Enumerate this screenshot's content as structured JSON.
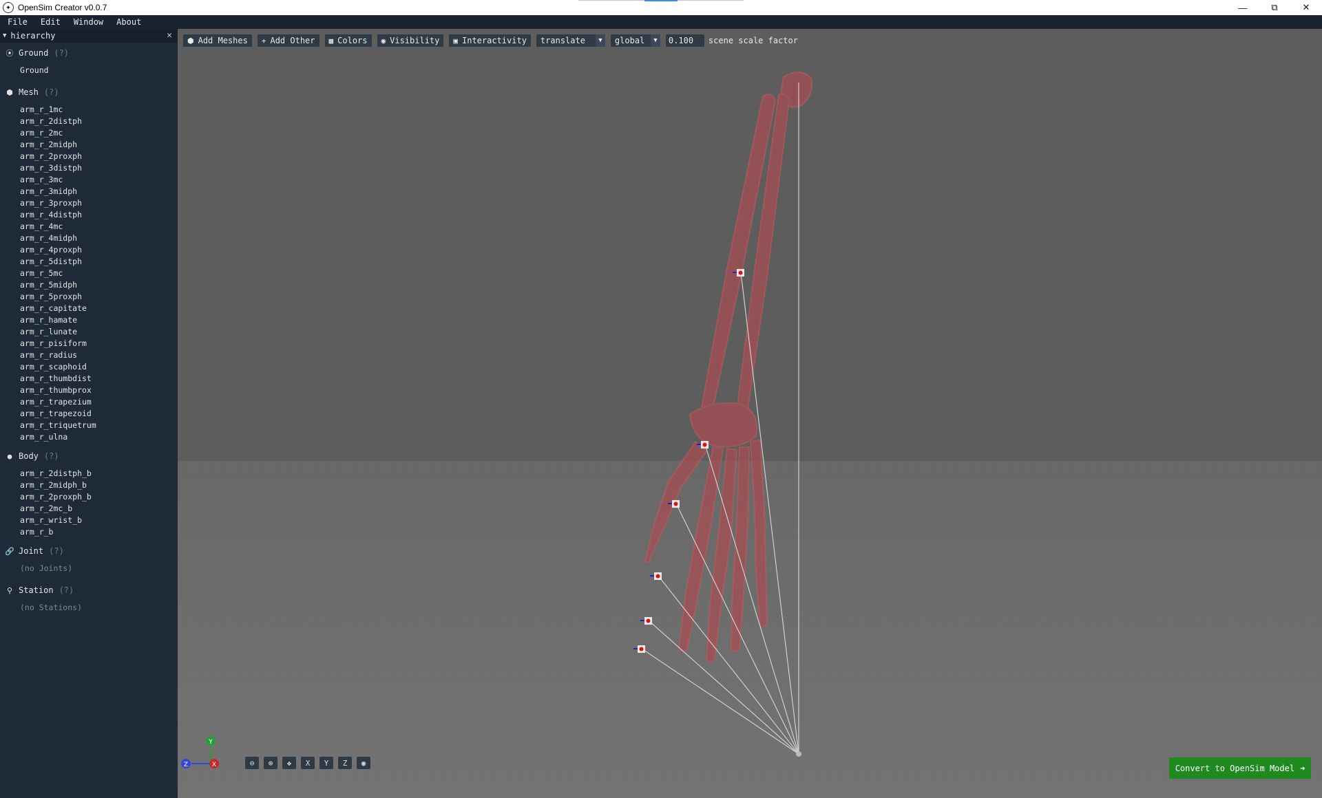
{
  "window": {
    "title": "OpenSim Creator v0.0.7"
  },
  "menu": [
    "File",
    "Edit",
    "Window",
    "About"
  ],
  "panel": {
    "title": "hierarchy"
  },
  "groups": {
    "ground": {
      "label": "Ground",
      "help": "(?)",
      "items": [
        "Ground"
      ]
    },
    "mesh": {
      "label": "Mesh",
      "help": "(?)",
      "items": [
        "arm_r_1mc",
        "arm_r_2distph",
        "arm_r_2mc",
        "arm_r_2midph",
        "arm_r_2proxph",
        "arm_r_3distph",
        "arm_r_3mc",
        "arm_r_3midph",
        "arm_r_3proxph",
        "arm_r_4distph",
        "arm_r_4mc",
        "arm_r_4midph",
        "arm_r_4proxph",
        "arm_r_5distph",
        "arm_r_5mc",
        "arm_r_5midph",
        "arm_r_5proxph",
        "arm_r_capitate",
        "arm_r_hamate",
        "arm_r_lunate",
        "arm_r_pisiform",
        "arm_r_radius",
        "arm_r_scaphoid",
        "arm_r_thumbdist",
        "arm_r_thumbprox",
        "arm_r_trapezium",
        "arm_r_trapezoid",
        "arm_r_triquetrum",
        "arm_r_ulna"
      ]
    },
    "body": {
      "label": "Body",
      "help": "(?)",
      "items": [
        "arm_r_2distph_b",
        "arm_r_2midph_b",
        "arm_r_2proxph_b",
        "arm_r_2mc_b",
        "arm_r_wrist_b",
        "arm_r_b"
      ]
    },
    "joint": {
      "label": "Joint",
      "help": "(?)",
      "empty": "(no Joints)"
    },
    "station": {
      "label": "Station",
      "help": "(?)",
      "empty": "(no Stations)"
    }
  },
  "toolbar": {
    "add_meshes": "Add Meshes",
    "add_other": "Add Other",
    "colors": "Colors",
    "visibility": "Visibility",
    "interactivity": "Interactivity",
    "manip_mode": "translate",
    "coord_space": "global",
    "scale_value": "0.100",
    "scale_label": "scene scale factor"
  },
  "axes": {
    "x": "X",
    "y": "Y",
    "z": "Z"
  },
  "view_tools": {
    "x": "X",
    "y": "Y",
    "z": "Z"
  },
  "convert_button": {
    "label": "Convert to OpenSim Model",
    "color": "#1f8a1f"
  },
  "colors": {
    "bone": "#b5555a",
    "background": "#1e2a38"
  }
}
